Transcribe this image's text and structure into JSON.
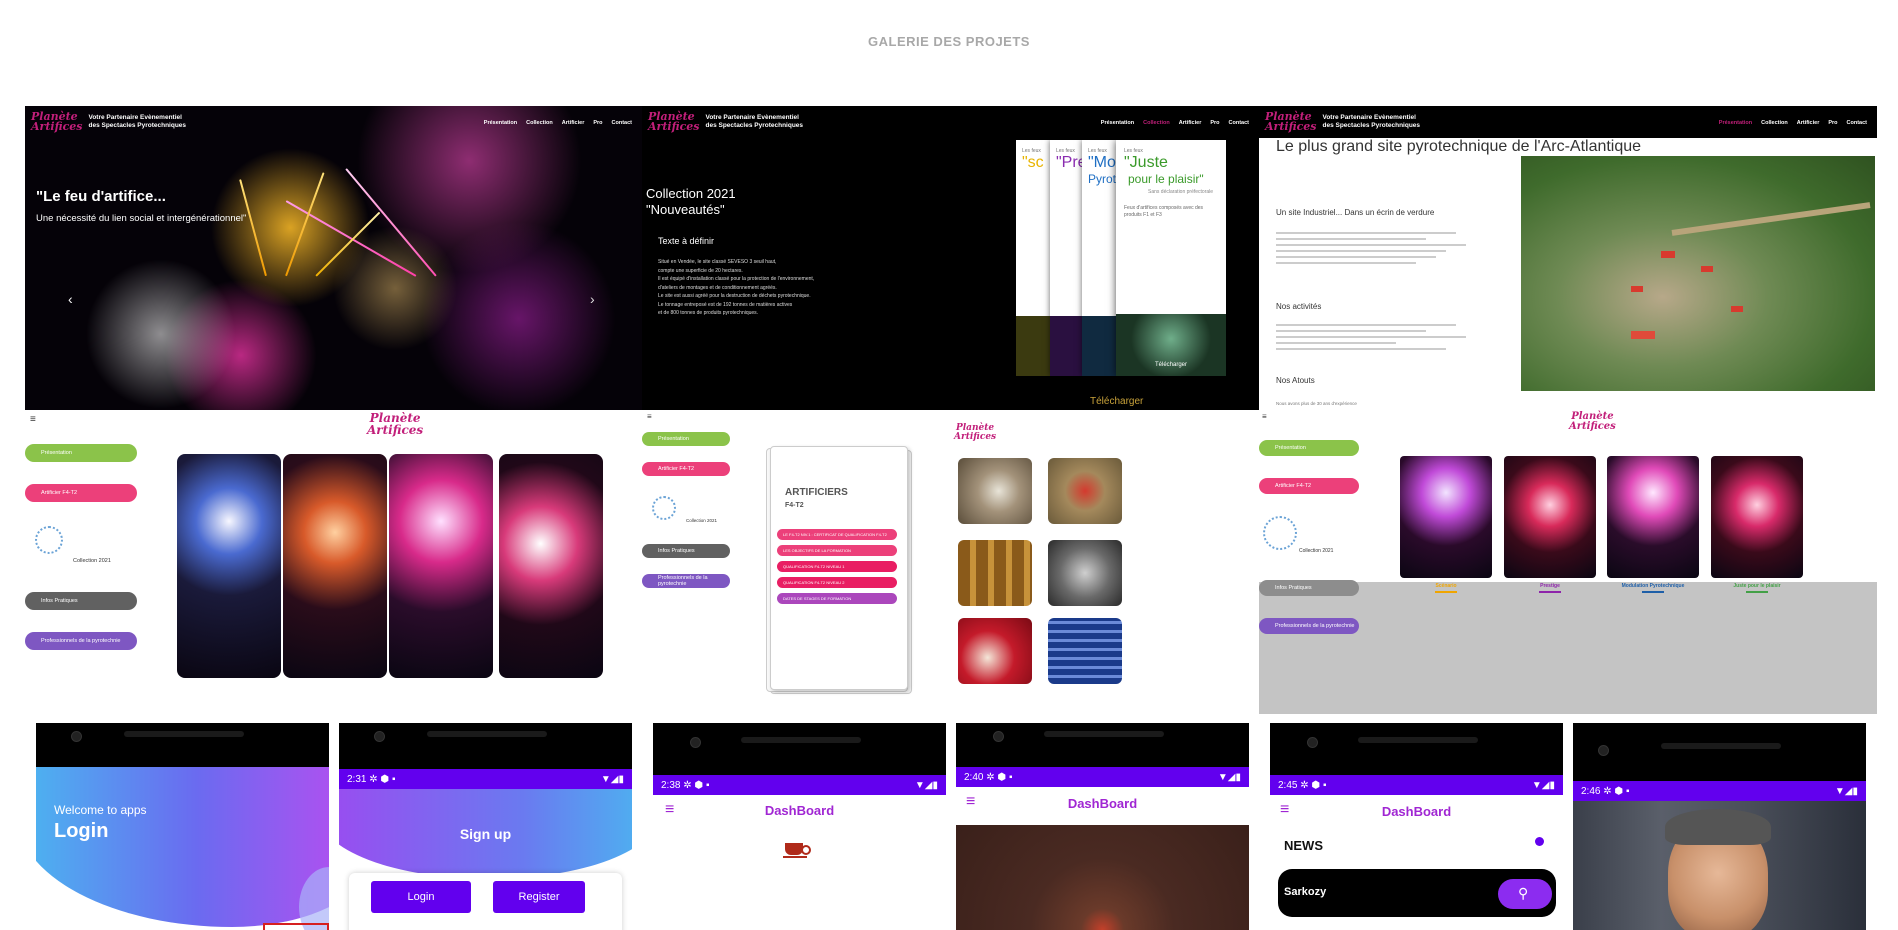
{
  "gallery_title": "GALERIE DES PROJETS",
  "site": {
    "logo_line1": "Planète",
    "logo_line2": "Artifices",
    "tagline_1": "Votre Partenaire Evènementiel",
    "tagline_2": "des Spectacles Pyrotechniques",
    "nav": [
      "Présentation",
      "Collection",
      "Artificier",
      "Pro",
      "Contact"
    ]
  },
  "tile1": {
    "headline": "\"Le feu d'artifice...",
    "subline": "Une nécessité du lien social et intergénérationnel\"",
    "prev_arrow": "‹",
    "next_arrow": "›"
  },
  "tile2": {
    "title_1": "Collection 2021",
    "title_2": "\"Nouveautés\"",
    "section": "Texte à définir",
    "paragraph": [
      "Situé en Vendée, le site classé SEVESO 3 seuil haut,",
      "compte une superficie de 20 hectares.",
      "Il est équipé d'installation classé pour la protection de l'environnement,",
      "d'ateliers de montages et de conditionnement agréés.",
      "Le site est aussi agréé pour la destruction de déchets pyrotechnique.",
      "Le tonnage entreposé est de 192 tonnes de matières actives",
      "et de 800 tonnes de produits pyrotechniques."
    ],
    "cards": [
      {
        "top": "Les feux",
        "title": "\"sc",
        "color": "#e8b400"
      },
      {
        "top": "Les feux",
        "title": "\"Pre",
        "color": "#8a2cb0"
      },
      {
        "top": "Les feux",
        "title": "\"Mod",
        "sub": "Pyrot",
        "color": "#1f6fc4"
      },
      {
        "top": "Les feux",
        "title": "\"Juste",
        "sub": "pour le plaisir\"",
        "note": "Sans déclaration préfectorale",
        "body": "Feux d'artifices composés avec des produits F1 et F3",
        "color": "#3a9a2a"
      }
    ],
    "card_button": "Télécharger",
    "download_link": "Télécharger"
  },
  "tile3": {
    "heading": "Le plus grand site pyrotechnique de l'Arc-Atlantique",
    "sub_1": "Un site Industriel... Dans un écrin de verdure",
    "sub_2": "Nos activités",
    "sub_3": "Nos Atouts",
    "atouts_line": "Nous avons plus de 30 ans d'expérience"
  },
  "app_menu": {
    "hamburger": "≡",
    "items": [
      {
        "label": "Présentation",
        "color": "#8bc34a"
      },
      {
        "label": "Artificier F4-T2",
        "color": "#ec407a"
      },
      {
        "label": "Collection 2021",
        "color": ""
      },
      {
        "label": "Infos Pratiques",
        "color": "#616161"
      },
      {
        "label": "Professionnels de la pyrotechnie",
        "color": "#7e57c2"
      }
    ]
  },
  "tile5": {
    "doc_title": "ARTIFICIERS",
    "doc_sub": "F4-T2",
    "doc_buttons": [
      "LE F4-T2 NIV.1 : CERTIFICAT DE QUALIFICATION F4-T2",
      "LES OBJECTIFS DE LA FORMATION",
      "QUALIFICATION F4-T2 NIVEAU 1",
      "QUALIFICATION F4-T2 NIVEAU 2",
      "DATES DE STAGES DE FORMATION"
    ]
  },
  "tile6": {
    "captions": [
      {
        "label": "Scénario",
        "color": "#f0a500"
      },
      {
        "label": "Prestige",
        "color": "#8e24aa"
      },
      {
        "label": "Modulation Pyrotechnique",
        "color": "#1e5fa8"
      },
      {
        "label": "Juste pour le plaisir",
        "color": "#43a047"
      }
    ]
  },
  "phones": [
    {
      "time": "",
      "title": "Login",
      "welcome": "Welcome to apps"
    },
    {
      "time": "2:31",
      "title": "Sign up",
      "btn_login": "Login",
      "btn_register": "Register"
    },
    {
      "time": "2:38",
      "title": "DashBoard"
    },
    {
      "time": "2:40",
      "title": "DashBoard"
    },
    {
      "time": "2:45",
      "title": "DashBoard",
      "section": "NEWS",
      "search_value": "Sarkozy"
    },
    {
      "time": "2:46"
    }
  ],
  "colors": {
    "accent_purple": "#6200ee",
    "magenta": "#c21f7a",
    "dash_purple": "#a026d3"
  },
  "icons": {
    "status": [
      "gear-icon",
      "shield-icon",
      "sim-icon",
      "wifi-icon",
      "signal-icon",
      "battery-icon"
    ],
    "search": "search-icon"
  }
}
